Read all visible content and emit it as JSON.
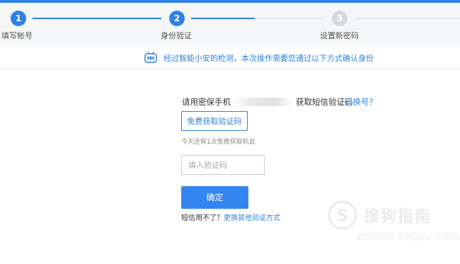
{
  "steps": [
    {
      "number": "1",
      "label": "填写帐号",
      "state": "done"
    },
    {
      "number": "2",
      "label": "身份验证",
      "state": "active"
    },
    {
      "number": "3",
      "label": "设置新密码",
      "state": "pending"
    }
  ],
  "notice": {
    "icon": "robot-icon",
    "text": "经过智能小安的检测，本次操作需要您通过以下方式确认身份"
  },
  "verify": {
    "phone_prefix": "请用密保手机",
    "phone_suffix": "获取短信验证码",
    "change_link": "已换号？",
    "send_button": "免费获取验证码",
    "remaining_text": "今天还有1次免费获取机会",
    "code_placeholder": "填入验证码",
    "code_value": "",
    "confirm_button": "确定",
    "help_prefix": "短信用不了？",
    "help_link": "更换其他验证方式"
  },
  "watermark": {
    "logo_glyph": "S",
    "text": "搜狗指南",
    "url": "zhinan.sogou.com"
  },
  "colors": {
    "accent": "#2e82e6",
    "button": "#3385f0",
    "inactive_step": "#d6d8db"
  }
}
